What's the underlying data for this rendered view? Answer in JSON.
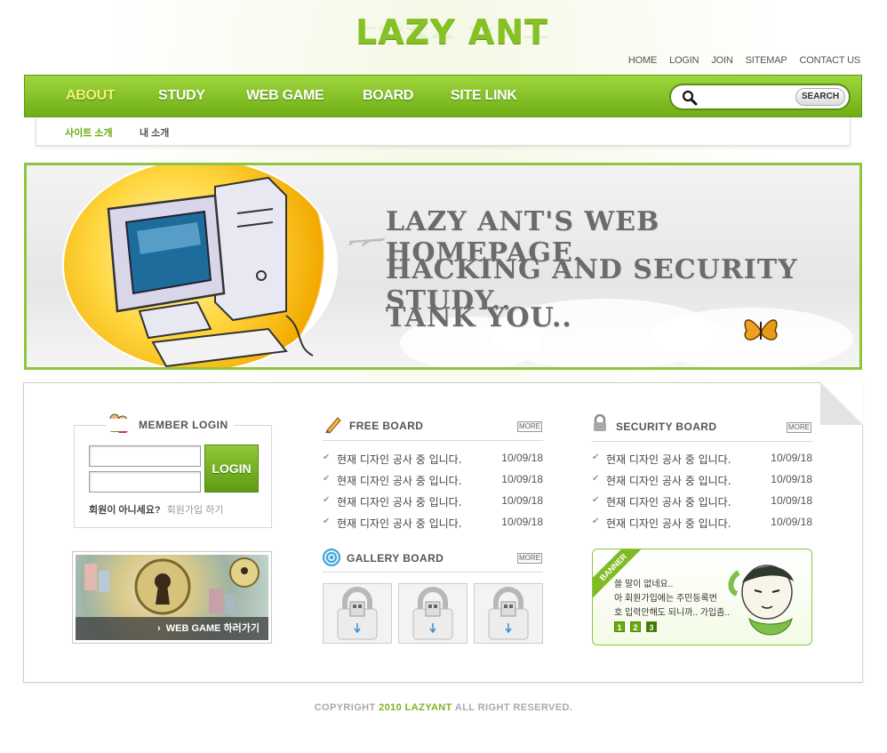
{
  "logo": {
    "text": "LAZY ANT"
  },
  "util_nav": [
    "HOME",
    "LOGIN",
    "JOIN",
    "SITEMAP",
    "CONTACT US"
  ],
  "main_nav": [
    {
      "label": "ABOUT",
      "active": true
    },
    {
      "label": "STUDY",
      "active": false
    },
    {
      "label": "WEB GAME",
      "active": false
    },
    {
      "label": "BOARD",
      "active": false
    },
    {
      "label": "SITE LINK",
      "active": false
    }
  ],
  "search": {
    "button_label": "SEARCH",
    "value": ""
  },
  "sub_nav": [
    {
      "label": "사이트 소개",
      "active": true
    },
    {
      "label": "내 소개",
      "active": false
    }
  ],
  "hero": {
    "lines": [
      "LAZY ANT'S WEB HOMEPAGE.",
      "HACKING AND SECURITY STUDY..",
      "TANK YOU.."
    ]
  },
  "member_login": {
    "title": "MEMBER LOGIN",
    "login_button": "LOGIN",
    "note_prefix": "회원이 아니세요?",
    "note_link": "회원가입 하기",
    "id_value": "",
    "password_value": ""
  },
  "game_banner": {
    "label": "WEB GAME 하러가기"
  },
  "free_board": {
    "title": "FREE BOARD",
    "more": "MORE",
    "posts": [
      {
        "title": "현재 디자인 공사 중 입니다.",
        "date": "10/09/18"
      },
      {
        "title": "현재 디자인 공사 중 입니다.",
        "date": "10/09/18"
      },
      {
        "title": "현재 디자인 공사 중 입니다.",
        "date": "10/09/18"
      },
      {
        "title": "현재 디자인 공사 중 입니다.",
        "date": "10/09/18"
      }
    ]
  },
  "security_board": {
    "title": "SECURITY BOARD",
    "more": "MORE",
    "posts": [
      {
        "title": "현재 디자인 공사 중 입니다.",
        "date": "10/09/18"
      },
      {
        "title": "현재 디자인 공사 중 입니다.",
        "date": "10/09/18"
      },
      {
        "title": "현재 디자인 공사 중 입니다.",
        "date": "10/09/18"
      },
      {
        "title": "현재 디자인 공사 중 입니다.",
        "date": "10/09/18"
      }
    ]
  },
  "gallery_board": {
    "title": "GALLERY BOARD",
    "more": "MORE"
  },
  "side_banner": {
    "ribbon": "BANNER",
    "lines": [
      "쓸 말이 없네요..",
      "아 회원가입에는 주민등록번",
      "호 입력안해도 되니까.. 가입좀.."
    ],
    "pages": [
      "1",
      "2",
      "3"
    ]
  },
  "footer": {
    "prefix": "COPYRIGHT",
    "year": "2010",
    "brand": "LAZYANT",
    "suffix": "ALL RIGHT RESERVED."
  },
  "colors": {
    "accent_green": "#8cc63f",
    "nav_active": "#f5f27a",
    "dark_green": "#5e9c13"
  }
}
